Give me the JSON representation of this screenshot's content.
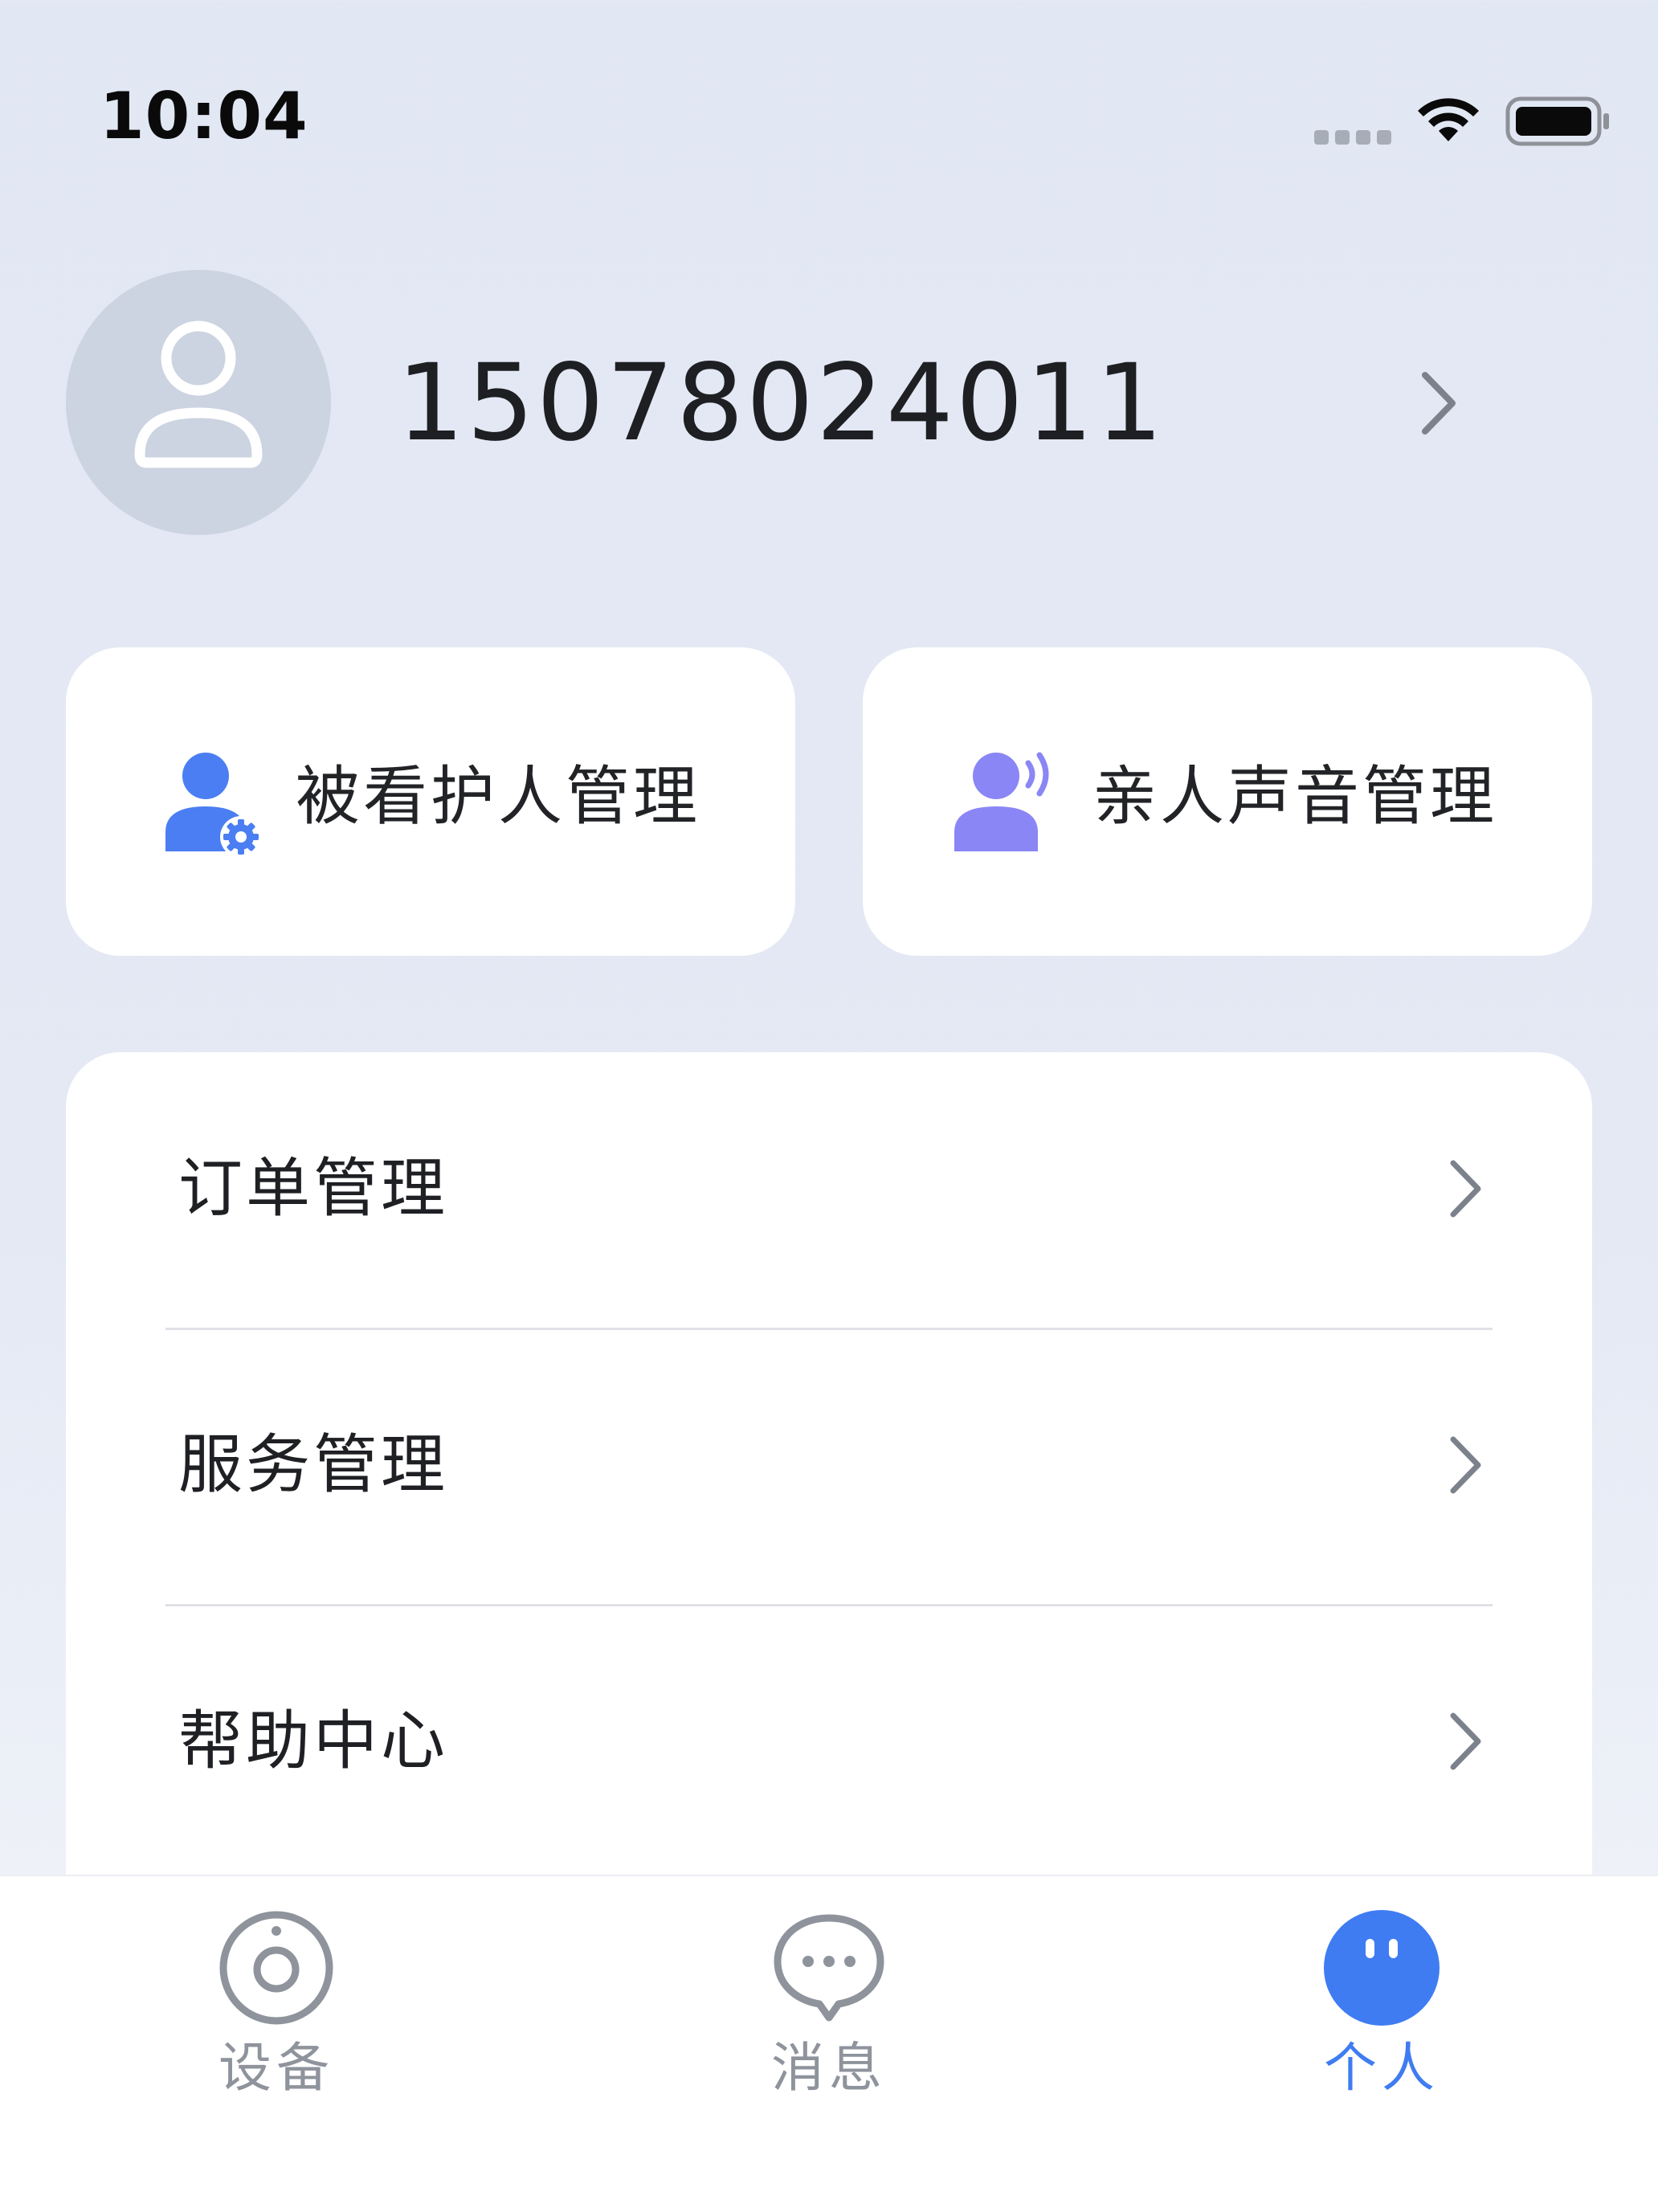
{
  "status_bar": {
    "time": "10:04",
    "signal_icon": "signal-dots-icon",
    "wifi_icon": "wifi-icon",
    "battery_icon": "battery-icon"
  },
  "profile": {
    "avatar_icon": "user-icon",
    "phone": "15078024011",
    "chevron_icon": "chevron-right-icon"
  },
  "quick_actions": [
    {
      "label": "被看护人管理",
      "icon": "user-settings-icon",
      "color": "#4b7ef2"
    },
    {
      "label": "亲人声音管理",
      "icon": "user-voice-icon",
      "color": "#8a86f5"
    }
  ],
  "menu": {
    "items": [
      {
        "label": "订单管理"
      },
      {
        "label": "服务管理"
      },
      {
        "label": "帮助中心"
      }
    ]
  },
  "tab_bar": {
    "tabs": [
      {
        "label": "设备",
        "icon": "device-camera-icon",
        "active": false
      },
      {
        "label": "消息",
        "icon": "chat-bubble-icon",
        "active": false
      },
      {
        "label": "个人",
        "icon": "profile-face-icon",
        "active": true
      }
    ]
  },
  "colors": {
    "accent": "#3f7cf2",
    "inactive": "#8e939c",
    "background": "#e2e7f4"
  }
}
